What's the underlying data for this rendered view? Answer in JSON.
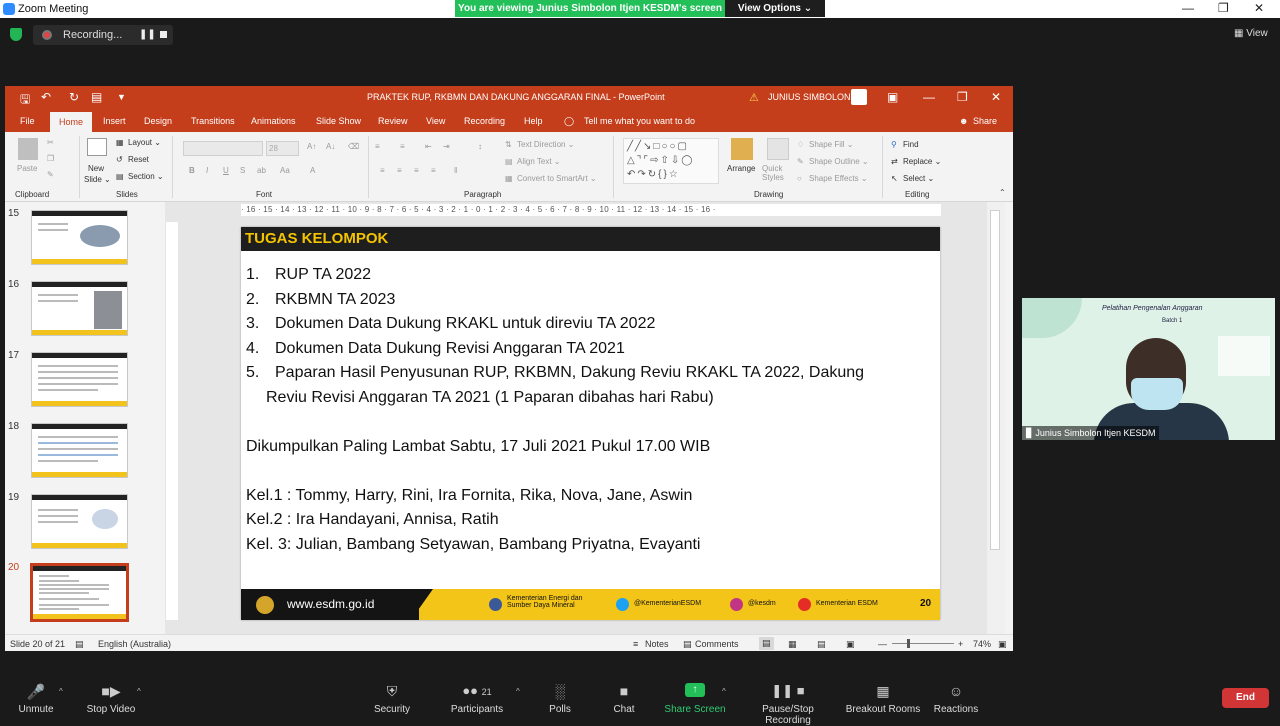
{
  "zoom": {
    "window_title": "Zoom Meeting",
    "banner": "You are viewing Junius Simbolon Itjen KESDM's screen",
    "view_options": "View Options ⌄",
    "recording_label": "Recording...",
    "view_label": "View",
    "participant_count": "21",
    "toolbar": {
      "unmute": "Unmute",
      "stop_video": "Stop Video",
      "security": "Security",
      "participants": "Participants",
      "polls": "Polls",
      "chat": "Chat",
      "share_screen": "Share Screen",
      "pause_stop_recording": "Pause/Stop Recording",
      "breakout_rooms": "Breakout Rooms",
      "reactions": "Reactions",
      "end": "End"
    },
    "video_tile": {
      "name": "Junius Simbolon Itjen KESDM",
      "bg_title": "Pelatihan Pengenalan Anggaran",
      "bg_subtitle": "Batch 1"
    }
  },
  "ppt": {
    "doc_title": "PRAKTEK RUP, RKBMN DAN DAKUNG ANGGARAN FINAL  -  PowerPoint",
    "user": "JUNIUS SIMBOLON",
    "tabs": [
      "File",
      "Home",
      "Insert",
      "Design",
      "Transitions",
      "Animations",
      "Slide Show",
      "Review",
      "View",
      "Recording",
      "Help"
    ],
    "tell_me": "Tell me what you want to do",
    "share": "Share",
    "ribbon": {
      "paste": "Paste",
      "new_slide_1": "New",
      "new_slide_2": "Slide ⌄",
      "layout": "Layout ⌄",
      "reset": "Reset",
      "section": "Section ⌄",
      "font_size": "28",
      "text_direction": "Text Direction ⌄",
      "align_text": "Align Text ⌄",
      "convert_smartart": "Convert to SmartArt ⌄",
      "arrange": "Arrange",
      "quick_styles": "Quick Styles",
      "shape_fill": "Shape Fill ⌄",
      "shape_outline": "Shape Outline ⌄",
      "shape_effects": "Shape Effects ⌄",
      "find": "Find",
      "replace": "Replace ⌄",
      "select": "Select ⌄",
      "groups": {
        "clipboard": "Clipboard",
        "slides": "Slides",
        "font": "Font",
        "paragraph": "Paragraph",
        "drawing": "Drawing",
        "editing": "Editing"
      }
    },
    "thumb_numbers": [
      "15",
      "16",
      "17",
      "18",
      "19",
      "20"
    ],
    "ruler_text": "· 16 · 15 · 14 · 13 · 12 · 11 · 10 · 9 · 8 · 7 · 6 · 5 · 4 · 3 · 2 · 1 · 0 · 1 · 2 · 3 · 4 · 5 · 6 · 7 · 8 · 9 · 10 · 11 · 12 · 13 · 14 · 15 · 16 ·",
    "status": {
      "slide": "Slide 20 of 21",
      "language": "English (Australia)",
      "notes": "Notes",
      "comments": "Comments",
      "zoom": "74%"
    }
  },
  "slide": {
    "heading": "TUGAS KELOMPOK",
    "items": [
      {
        "num": "1.",
        "text": "RUP TA 2022"
      },
      {
        "num": "2.",
        "text": "RKBMN TA 2023"
      },
      {
        "num": "3.",
        "text": "Dokumen Data Dukung RKAKL untuk direviu TA 2022"
      },
      {
        "num": "4.",
        "text": "Dokumen Data Dukung Revisi Anggaran TA 2021"
      },
      {
        "num": "5.",
        "text": "Paparan Hasil Penyusunan RUP, RKBMN, Dakung Reviu RKAKL TA 2022, Dakung"
      }
    ],
    "item5_cont": "Reviu Revisi Anggaran TA 2021 (1 Paparan dibahas hari Rabu)",
    "deadline": "Dikumpulkan Paling Lambat Sabtu, 17 Juli 2021 Pukul 17.00 WIB",
    "groups": [
      "Kel.1 : Tommy, Harry, Rini, Ira Fornita, Rika, Nova, Jane, Aswin",
      "Kel.2 : Ira Handayani, Annisa, Ratih",
      "Kel. 3: Julian, Bambang Setyawan, Bambang Priyatna, Evayanti"
    ],
    "footer": {
      "url": "www.esdm.go.id",
      "fb": "Kementerian Energi dan Sumber Daya Mineral",
      "tw": "@KementerianESDM",
      "ig": "@kesdm",
      "yt": "Kementerian ESDM",
      "page": "20"
    }
  },
  "colors": {
    "ppt_accent": "#c43e1c",
    "slide_header_bg": "#1e1e1e",
    "slide_header_text": "#f5c400",
    "zoom_banner": "#23c05a",
    "end_button": "#d13535"
  }
}
